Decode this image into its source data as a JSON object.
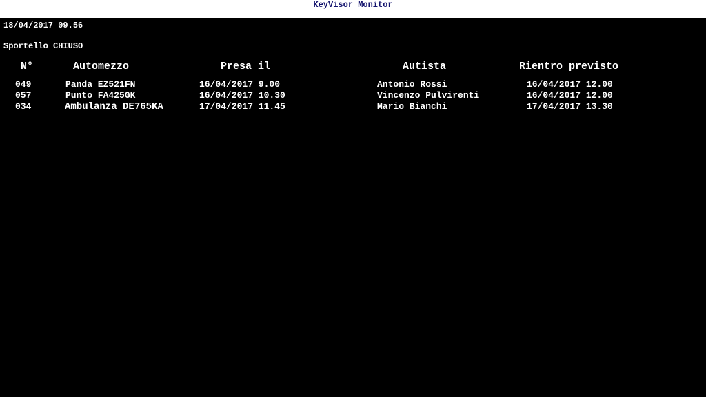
{
  "window": {
    "title": "KeyVisor Monitor"
  },
  "header": {
    "datetime": "18/04/2017 09.56",
    "status_label": "Sportello",
    "status_value": "CHIUSO"
  },
  "table": {
    "columns": [
      "N°",
      "Automezzo",
      "Presa il",
      "Autista",
      "Rientro previsto"
    ],
    "rows": [
      {
        "number": "049",
        "vehicle": "Panda EZ521FN",
        "taken": "16/04/2017 9.00",
        "driver": "Antonio Rossi",
        "return": "16/04/2017 12.00"
      },
      {
        "number": "057",
        "vehicle": "Punto FA425GK",
        "taken": "16/04/2017 10.30",
        "driver": "Vincenzo Pulvirenti",
        "return": "16/04/2017 12.00"
      },
      {
        "number": "034",
        "vehicle": "Ambulanza DE765KA",
        "taken": "17/04/2017 11.45",
        "driver": "Mario Bianchi",
        "return": "17/04/2017 13.30"
      }
    ]
  },
  "colors": {
    "background": "#000000",
    "text": "#ffffff",
    "title_text": "#14146e",
    "title_bar": "#ffffff"
  }
}
